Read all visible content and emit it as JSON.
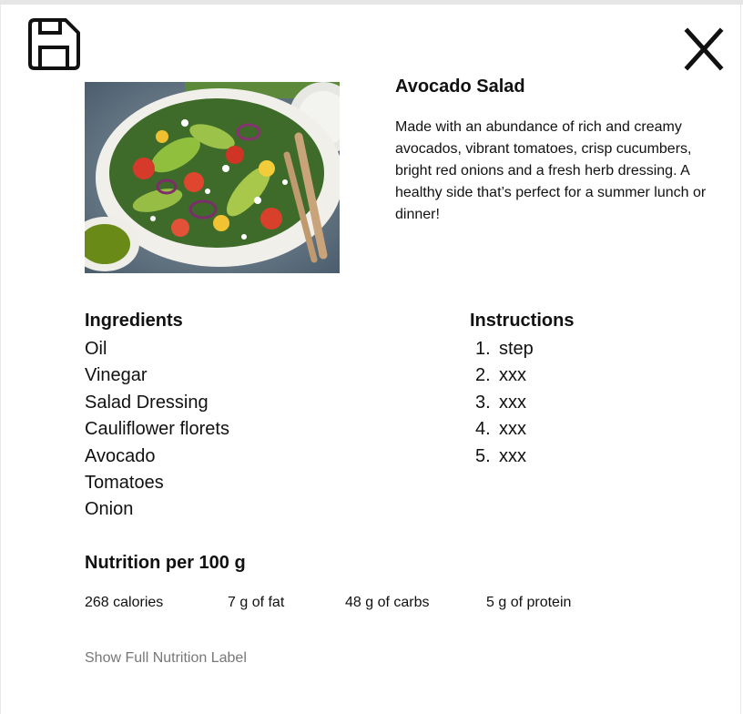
{
  "recipe": {
    "title": "Avocado Salad",
    "description": "Made with an abundance of rich and creamy avocados, vibrant  tomatoes, crisp cucumbers, bright red onions and a fresh herb dressing. A healthy side that’s perfect for a summer lunch or dinner!"
  },
  "toolbar": {
    "save_icon": "floppy-disk-icon",
    "close_icon": "close-x-icon"
  },
  "ingredients": {
    "heading": "Ingredients",
    "items": [
      "Oil",
      "Vinegar",
      "Salad Dressing",
      "Cauliflower florets",
      "Avocado",
      "Tomatoes",
      "Onion"
    ]
  },
  "instructions": {
    "heading": "Instructions",
    "steps": [
      {
        "num": "1.",
        "text": "step"
      },
      {
        "num": "2.",
        "text": "xxx"
      },
      {
        "num": "3.",
        "text": "xxx"
      },
      {
        "num": "4.",
        "text": "xxx"
      },
      {
        "num": "5.",
        "text": "xxx"
      }
    ]
  },
  "nutrition": {
    "heading": "Nutrition per 100 g",
    "facts": [
      "268 calories",
      "7 g of fat",
      "48 g of carbs",
      "5 g of protein"
    ],
    "full_label_link": "Show Full Nutrition Label"
  },
  "colors": {
    "text": "#111111",
    "muted_link": "#777777"
  }
}
